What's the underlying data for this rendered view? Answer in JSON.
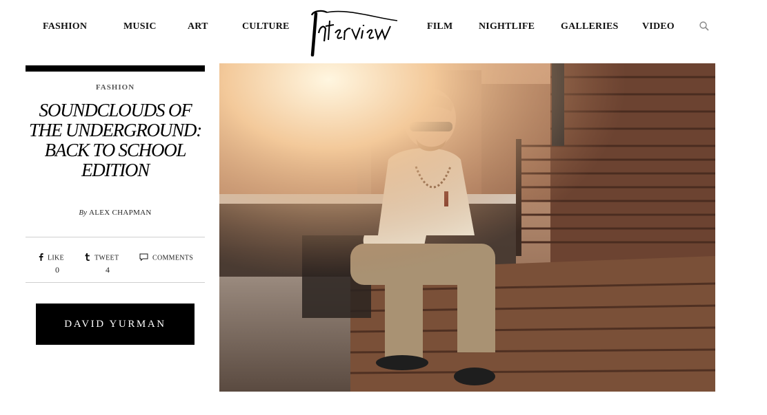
{
  "nav": {
    "left": [
      "FASHION",
      "MUSIC",
      "ART",
      "CULTURE"
    ],
    "right": [
      "FILM",
      "NIGHTLIFE",
      "GALLERIES",
      "VIDEO"
    ],
    "logo": "Interview"
  },
  "article": {
    "category": "FASHION",
    "title": "SOUNDCLOUDS OF THE UNDERGROUND: BACK TO SCHOOL EDITION",
    "byline_prefix": "By",
    "author": "ALEX CHAPMAN"
  },
  "share": {
    "like_label": "LIKE",
    "like_count": "0",
    "tweet_label": "TWEET",
    "tweet_count": "4",
    "comments_label": "COMMENTS"
  },
  "ad": {
    "text": "DAVID YURMAN"
  },
  "icons": {
    "search": "search-icon",
    "facebook": "facebook-icon",
    "tumblr": "tumblr-icon",
    "comment": "comment-icon"
  },
  "colors": {
    "text": "#111111",
    "rule": "#cfcfcf",
    "ad_bg": "#000000"
  }
}
